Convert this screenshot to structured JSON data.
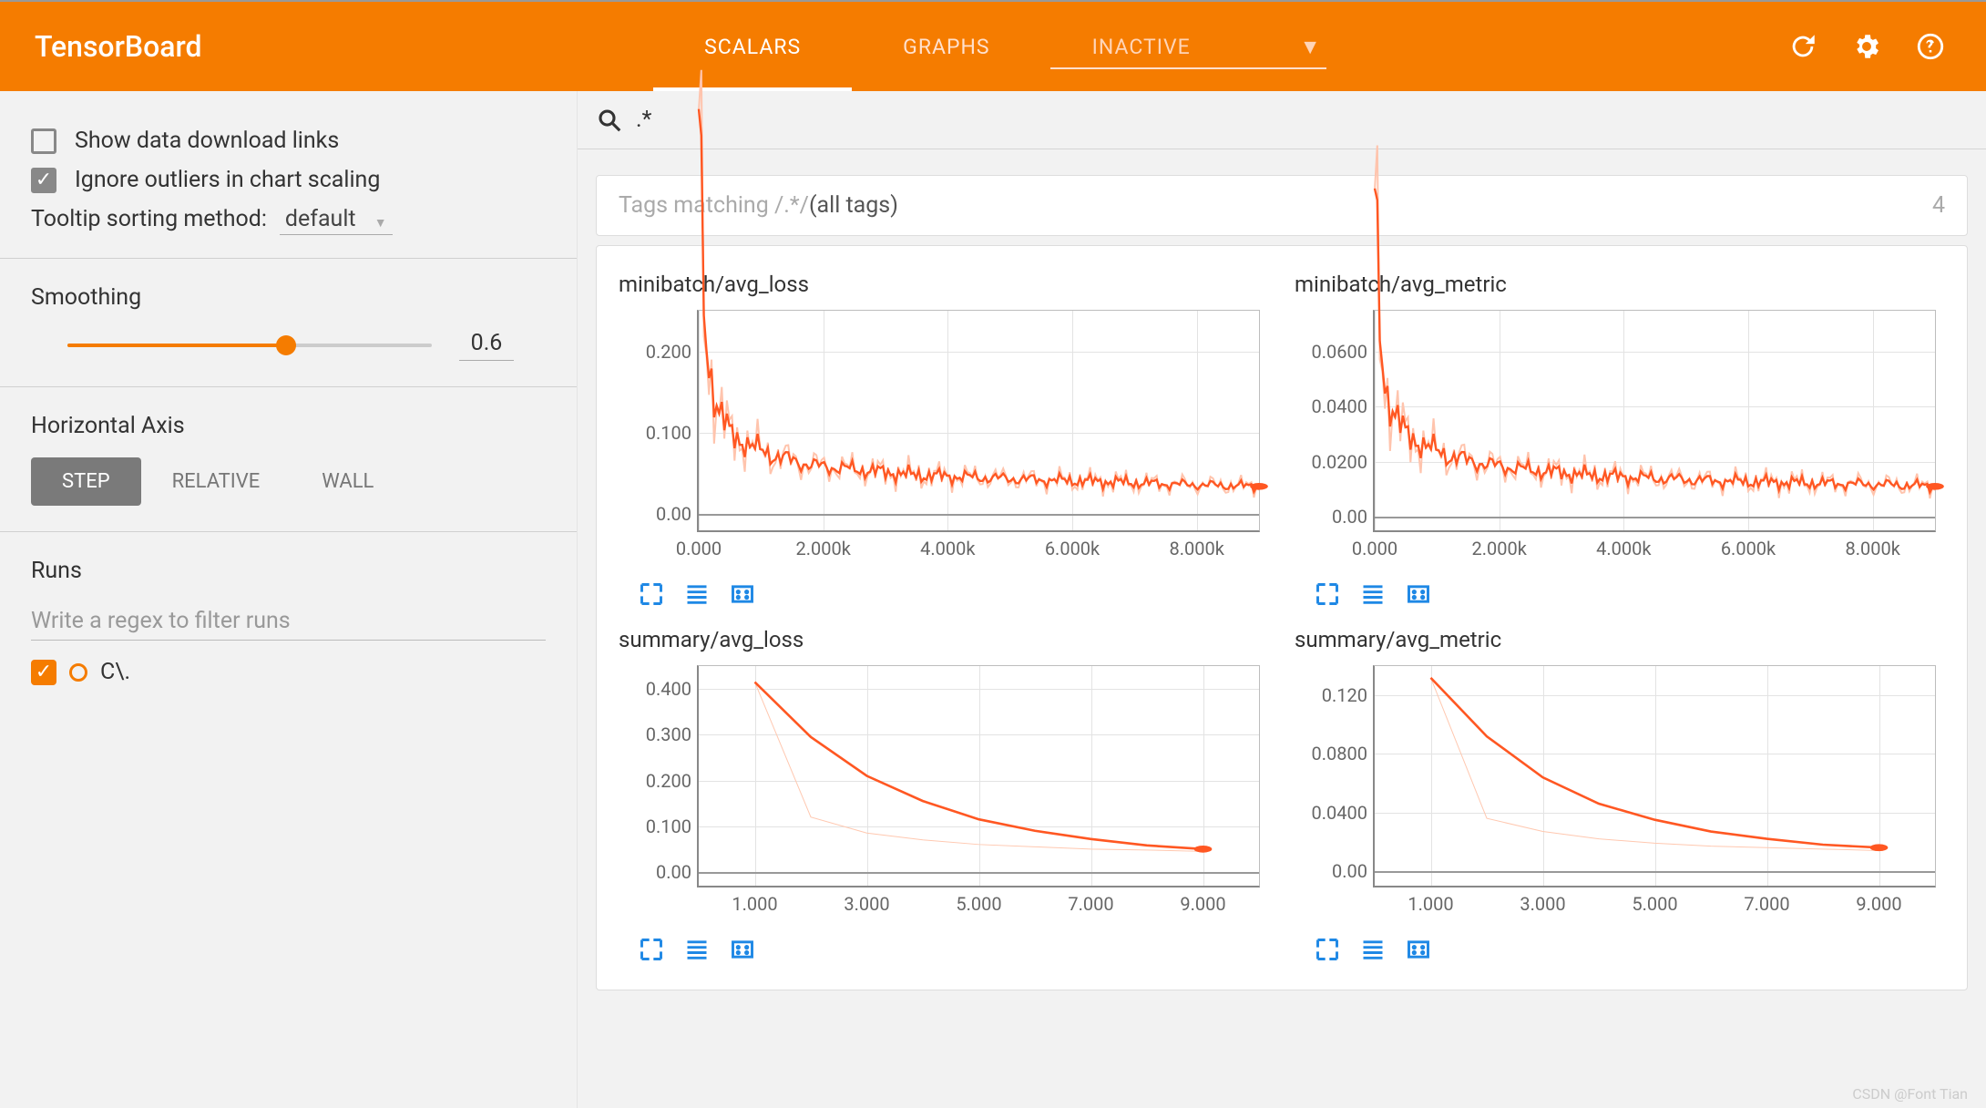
{
  "header": {
    "title": "TensorBoard",
    "tabs": {
      "scalars": "SCALARS",
      "graphs": "GRAPHS",
      "inactive": "INACTIVE"
    }
  },
  "sidebar": {
    "showDownload": "Show data download links",
    "ignoreOutliers": "Ignore outliers in chart scaling",
    "tooltipLabel": "Tooltip sorting method:",
    "tooltipValue": "default",
    "smoothingLabel": "Smoothing",
    "smoothingValue": "0.6",
    "hAxisLabel": "Horizontal Axis",
    "hAxis": {
      "step": "STEP",
      "relative": "RELATIVE",
      "wall": "WALL"
    },
    "runsLabel": "Runs",
    "runsFilterPlaceholder": "Write a regex to filter runs",
    "run": "C\\."
  },
  "content": {
    "searchValue": ".*",
    "tagsPrefix": "Tags matching /",
    "tagsPattern": ".*",
    "tagsSuffix": "/ ",
    "tagsAll": "(all tags)",
    "tagsCount": "4"
  },
  "watermark": "CSDN @Font Tian",
  "chart_data": [
    {
      "title": "minibatch/avg_loss",
      "type": "line",
      "xlabel": "",
      "ylabel": "",
      "xticks": [
        "0.000",
        "2.000k",
        "4.000k",
        "6.000k",
        "8.000k"
      ],
      "yticks": [
        "0.00",
        "0.100",
        "0.200"
      ],
      "xlim": [
        0,
        9000
      ],
      "ylim": [
        -0.02,
        0.25
      ],
      "series": [
        {
          "name": "C\\.",
          "color": "#ff5722",
          "x": [
            0,
            100,
            200,
            300,
            500,
            800,
            1200,
            1800,
            2500,
            3500,
            4500,
            5500,
            6500,
            7500,
            8500,
            9000
          ],
          "y": [
            0.5,
            0.22,
            0.17,
            0.13,
            0.1,
            0.085,
            0.072,
            0.06,
            0.055,
            0.048,
            0.045,
            0.042,
            0.04,
            0.037,
            0.035,
            0.034
          ]
        }
      ],
      "noisy": true,
      "endDot": true
    },
    {
      "title": "minibatch/avg_metric",
      "type": "line",
      "xticks": [
        "0.000",
        "2.000k",
        "4.000k",
        "6.000k",
        "8.000k"
      ],
      "yticks": [
        "0.00",
        "0.0200",
        "0.0400",
        "0.0600"
      ],
      "xlim": [
        0,
        9000
      ],
      "ylim": [
        -0.005,
        0.075
      ],
      "series": [
        {
          "name": "C\\.",
          "color": "#ff5722",
          "x": [
            0,
            100,
            200,
            300,
            500,
            800,
            1200,
            1800,
            2500,
            3500,
            4500,
            5500,
            6500,
            7500,
            8500,
            9000
          ],
          "y": [
            0.12,
            0.06,
            0.045,
            0.038,
            0.03,
            0.026,
            0.022,
            0.019,
            0.017,
            0.015,
            0.014,
            0.013,
            0.0125,
            0.012,
            0.0115,
            0.011
          ]
        }
      ],
      "noisy": true,
      "endDot": true
    },
    {
      "title": "summary/avg_loss",
      "type": "line",
      "xticks": [
        "1.000",
        "3.000",
        "5.000",
        "7.000",
        "9.000"
      ],
      "yticks": [
        "0.00",
        "0.100",
        "0.200",
        "0.300",
        "0.400"
      ],
      "xlim": [
        0,
        10
      ],
      "ylim": [
        -0.03,
        0.45
      ],
      "series": [
        {
          "name": "C\\.",
          "color": "#ff5722",
          "x": [
            1,
            2,
            3,
            4,
            5,
            6,
            7,
            8,
            9
          ],
          "y": [
            0.415,
            0.295,
            0.21,
            0.155,
            0.115,
            0.09,
            0.072,
            0.058,
            0.05
          ]
        }
      ],
      "faint": [
        {
          "x": [
            1,
            2,
            3,
            4,
            5,
            6,
            7,
            8,
            9
          ],
          "y": [
            0.415,
            0.12,
            0.085,
            0.07,
            0.06,
            0.055,
            0.05,
            0.048,
            0.045
          ]
        }
      ],
      "endDot": true
    },
    {
      "title": "summary/avg_metric",
      "type": "line",
      "xticks": [
        "1.000",
        "3.000",
        "5.000",
        "7.000",
        "9.000"
      ],
      "yticks": [
        "0.00",
        "0.0400",
        "0.0800",
        "0.120"
      ],
      "xlim": [
        0,
        10
      ],
      "ylim": [
        -0.01,
        0.14
      ],
      "series": [
        {
          "name": "C\\.",
          "color": "#ff5722",
          "x": [
            1,
            2,
            3,
            4,
            5,
            6,
            7,
            8,
            9
          ],
          "y": [
            0.132,
            0.092,
            0.064,
            0.046,
            0.035,
            0.027,
            0.022,
            0.018,
            0.016
          ]
        }
      ],
      "faint": [
        {
          "x": [
            1,
            2,
            3,
            4,
            5,
            6,
            7,
            8,
            9
          ],
          "y": [
            0.132,
            0.036,
            0.027,
            0.022,
            0.019,
            0.017,
            0.016,
            0.015,
            0.014
          ]
        }
      ],
      "endDot": true
    }
  ]
}
